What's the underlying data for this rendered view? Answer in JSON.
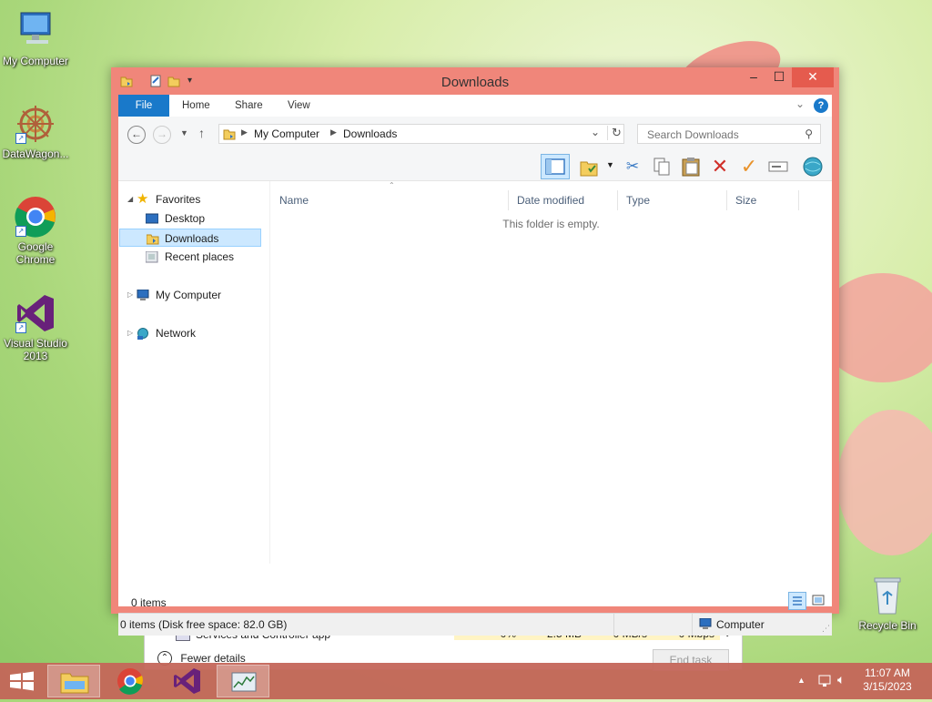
{
  "desktop": {
    "icons": [
      {
        "label": "My Computer"
      },
      {
        "label": "DataWagon..."
      },
      {
        "label": "Google Chrome"
      },
      {
        "label": "Visual Studio 2013"
      },
      {
        "label": "Recycle Bin"
      }
    ]
  },
  "task_manager": {
    "process_name": "Services and Controller app",
    "cpu": "0%",
    "memory": "2.5 MB",
    "disk": "0 MB/s",
    "network": "0 Mbps",
    "fewer_details": "Fewer details",
    "end_task": "End task"
  },
  "window": {
    "title": "Downloads",
    "ribbon_tabs": {
      "file": "File",
      "home": "Home",
      "share": "Share",
      "view": "View"
    },
    "breadcrumb": {
      "root": "My Computer",
      "current": "Downloads"
    },
    "search": {
      "placeholder": "Search Downloads"
    },
    "toolbar_icons": [
      "layout-pane-icon",
      "folder-check-icon",
      "cut-icon",
      "copy-icon",
      "paste-icon",
      "delete-icon",
      "checkmark-icon",
      "rename-icon",
      "globe-icon"
    ],
    "navigation": {
      "favorites": "Favorites",
      "desktop": "Desktop",
      "downloads": "Downloads",
      "recent_places": "Recent places",
      "my_computer": "My Computer",
      "network": "Network"
    },
    "columns": {
      "name": "Name",
      "date_modified": "Date modified",
      "type": "Type",
      "size": "Size"
    },
    "empty_message": "This folder is empty.",
    "item_count": "0 items",
    "status_text": "0 items (Disk free space: 82.0 GB)",
    "status_location": "Computer"
  },
  "taskbar": {
    "apps": [
      "file-explorer",
      "google-chrome",
      "visual-studio",
      "task-manager"
    ],
    "clock": {
      "time": "11:07 AM",
      "date": "3/15/2023"
    }
  },
  "colors": {
    "window_frame": "#f0867a",
    "close_button": "#e55b4e",
    "file_tab": "#1979ca",
    "selection": "#cce8ff",
    "taskbar": "#c4665a"
  }
}
